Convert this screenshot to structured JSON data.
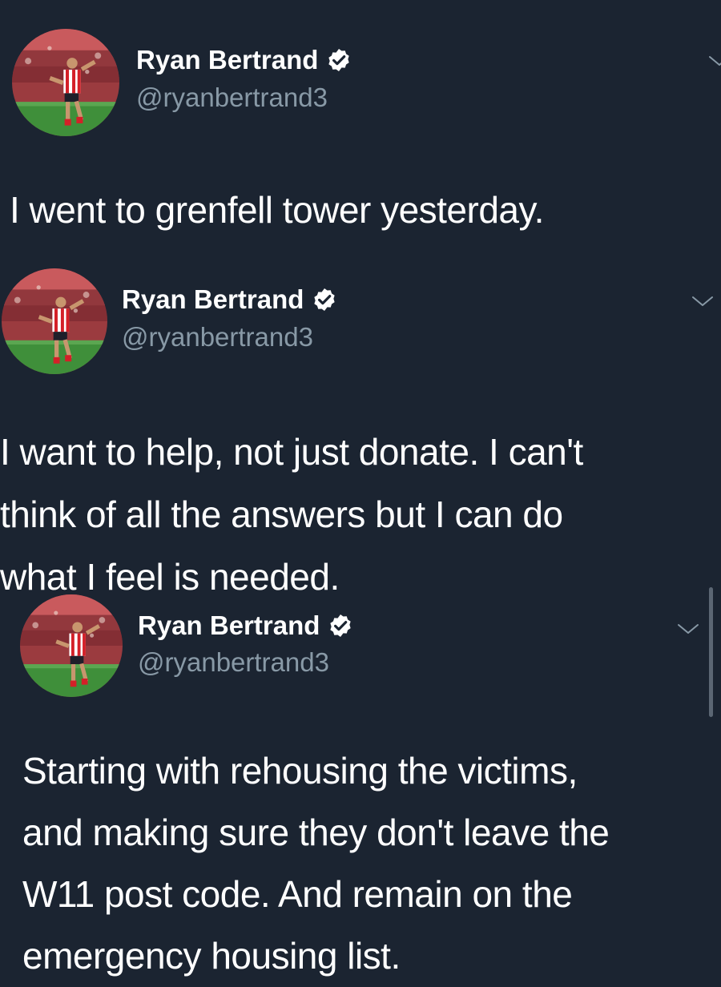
{
  "tweets": [
    {
      "display_name": "Ryan Bertrand",
      "handle": "@ryanbertrand3",
      "text": "I went to grenfell tower yesterday.",
      "verified": true
    },
    {
      "display_name": "Ryan Bertrand",
      "handle": "@ryanbertrand3",
      "text": "I want to help, not just donate. I can't\nthink of all the answers but I can do\nwhat I feel is needed.",
      "verified": true
    },
    {
      "display_name": "Ryan Bertrand",
      "handle": "@ryanbertrand3",
      "text": "Starting with rehousing the victims,\nand making sure they don't leave the\nW11 post code. And remain on the\nemergency housing list.",
      "verified": true
    }
  ],
  "icons": {
    "verified": "verified-badge-icon",
    "more": "chevron-down-icon"
  },
  "colors": {
    "background": "#1b2431",
    "text": "#ffffff",
    "secondary_text": "#8899a6",
    "chevron": "#8899a6"
  }
}
